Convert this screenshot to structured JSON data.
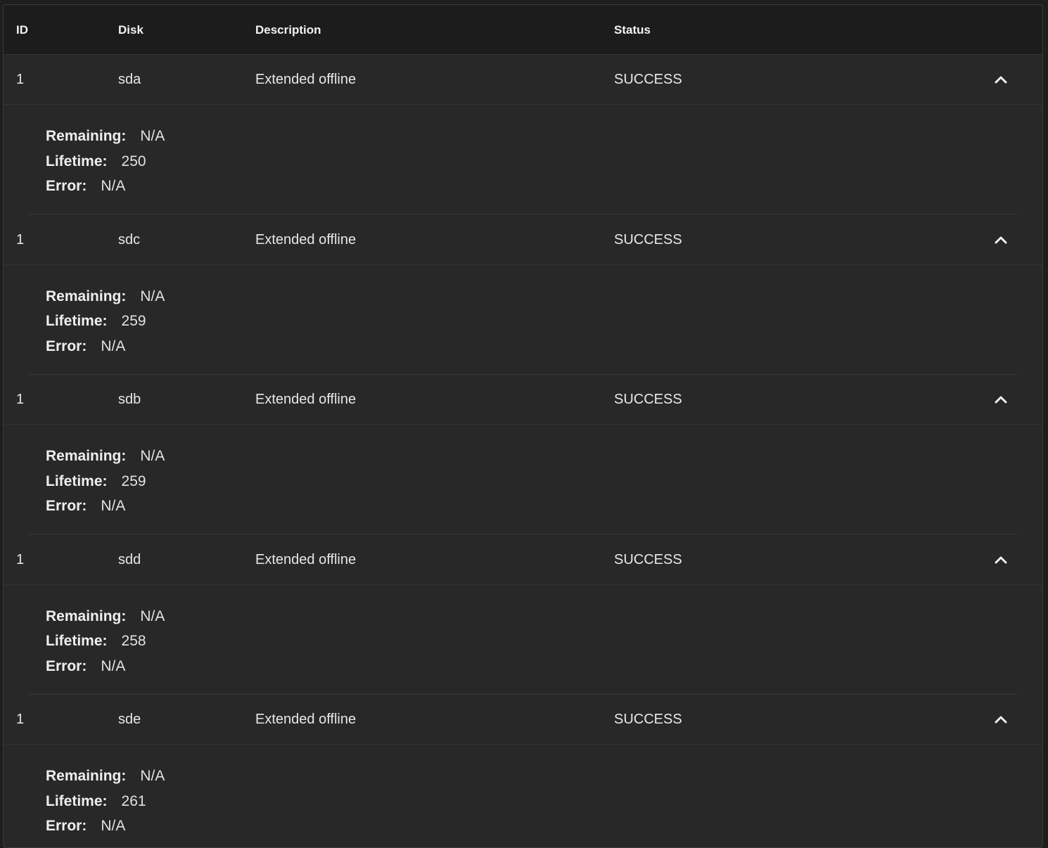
{
  "table": {
    "headers": {
      "id": "ID",
      "disk": "Disk",
      "description": "Description",
      "status": "Status"
    },
    "detail_labels": {
      "remaining": "Remaining:",
      "lifetime": "Lifetime:",
      "error": "Error:"
    },
    "rows": [
      {
        "id": "1",
        "disk": "sda",
        "description": "Extended offline",
        "status": "SUCCESS",
        "remaining": "N/A",
        "lifetime": "250",
        "error": "N/A"
      },
      {
        "id": "1",
        "disk": "sdc",
        "description": "Extended offline",
        "status": "SUCCESS",
        "remaining": "N/A",
        "lifetime": "259",
        "error": "N/A"
      },
      {
        "id": "1",
        "disk": "sdb",
        "description": "Extended offline",
        "status": "SUCCESS",
        "remaining": "N/A",
        "lifetime": "259",
        "error": "N/A"
      },
      {
        "id": "1",
        "disk": "sdd",
        "description": "Extended offline",
        "status": "SUCCESS",
        "remaining": "N/A",
        "lifetime": "258",
        "error": "N/A"
      },
      {
        "id": "1",
        "disk": "sde",
        "description": "Extended offline",
        "status": "SUCCESS",
        "remaining": "N/A",
        "lifetime": "261",
        "error": "N/A"
      }
    ],
    "toggle_icon": "chevron-up-icon"
  }
}
